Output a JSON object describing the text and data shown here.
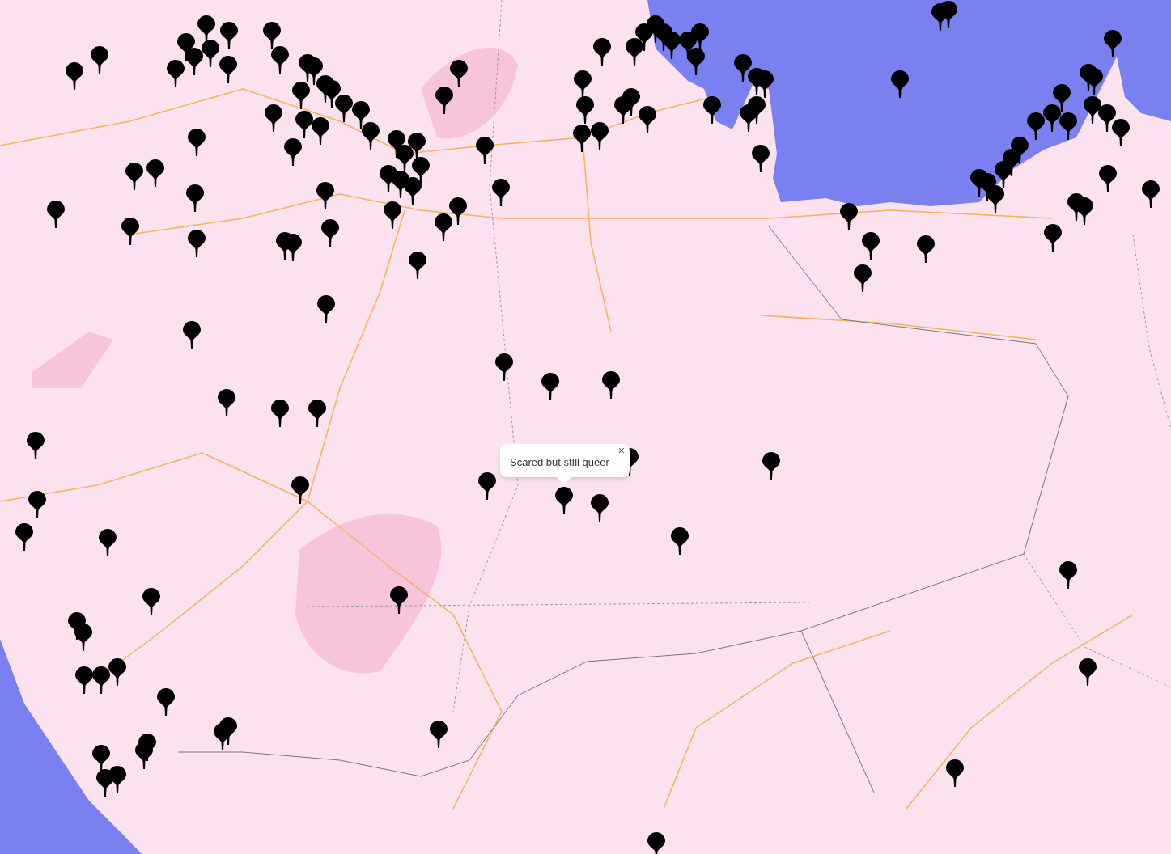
{
  "popup": {
    "text": "Scared but stIll queer",
    "close": "×"
  }
}
